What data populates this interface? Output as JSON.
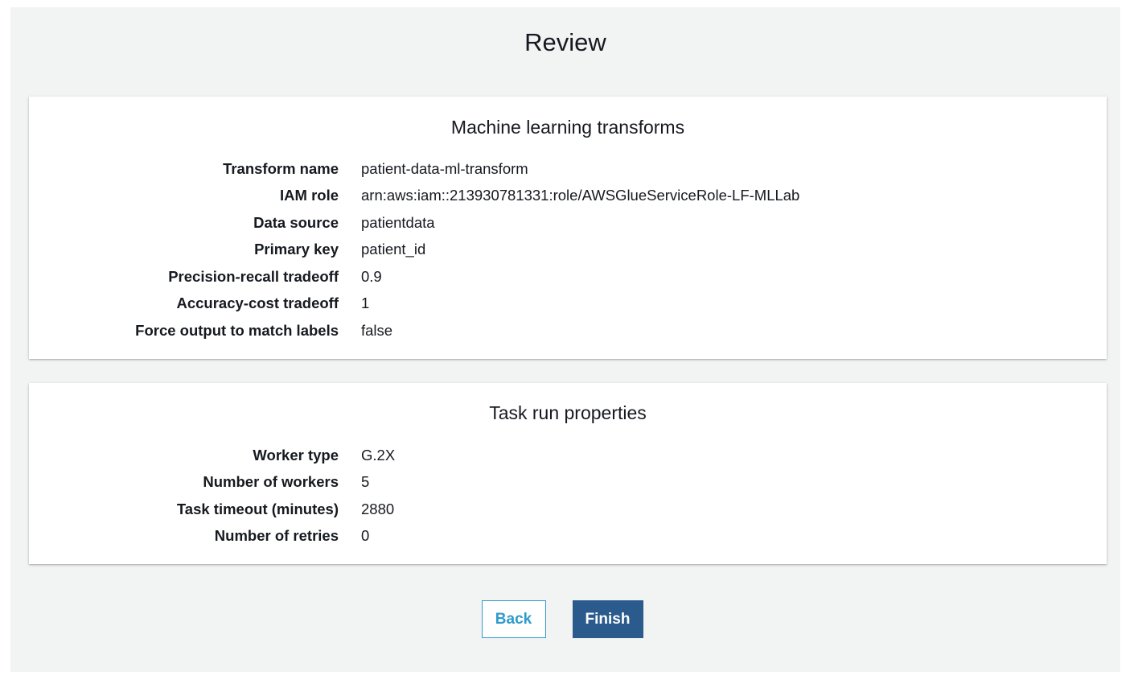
{
  "page": {
    "title": "Review"
  },
  "ml_transforms": {
    "title": "Machine learning transforms",
    "rows": [
      {
        "label": "Transform name",
        "value": "patient-data-ml-transform"
      },
      {
        "label": "IAM role",
        "value": "arn:aws:iam::213930781331:role/AWSGlueServiceRole-LF-MLLab"
      },
      {
        "label": "Data source",
        "value": "patientdata"
      },
      {
        "label": "Primary key",
        "value": "patient_id"
      },
      {
        "label": "Precision-recall tradeoff",
        "value": "0.9"
      },
      {
        "label": "Accuracy-cost tradeoff",
        "value": "1"
      },
      {
        "label": "Force output to match labels",
        "value": "false"
      }
    ]
  },
  "task_run": {
    "title": "Task run properties",
    "rows": [
      {
        "label": "Worker type",
        "value": "G.2X"
      },
      {
        "label": "Number of workers",
        "value": "5"
      },
      {
        "label": "Task timeout (minutes)",
        "value": "2880"
      },
      {
        "label": "Number of retries",
        "value": "0"
      }
    ]
  },
  "actions": {
    "back_label": "Back",
    "finish_label": "Finish"
  },
  "colors": {
    "background": "#f2f3f3",
    "panel": "#ffffff",
    "primary_button": "#2a5b8c",
    "secondary_button_text": "#2e9acc"
  }
}
